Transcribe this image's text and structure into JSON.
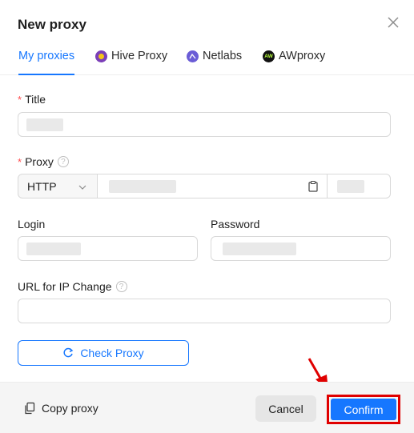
{
  "dialog": {
    "title": "New proxy"
  },
  "tabs": [
    {
      "label": "My proxies",
      "active": true
    },
    {
      "label": "Hive Proxy",
      "icon": "hive-proxy-logo-icon"
    },
    {
      "label": "Netlabs",
      "icon": "netlabs-logo-icon"
    },
    {
      "label": "AWproxy",
      "icon": "awproxy-logo-icon",
      "icon_text": "AW"
    }
  ],
  "form": {
    "title_label": "Title",
    "proxy_label": "Proxy",
    "proxy_type": "HTTP",
    "login_label": "Login",
    "password_label": "Password",
    "url_label": "URL for IP Change",
    "check_button": "Check Proxy"
  },
  "footer": {
    "copy_label": "Copy proxy",
    "cancel_label": "Cancel",
    "confirm_label": "Confirm"
  },
  "colors": {
    "accent": "#1677ff",
    "required": "#ff4d4f",
    "highlight": "#e00000"
  }
}
